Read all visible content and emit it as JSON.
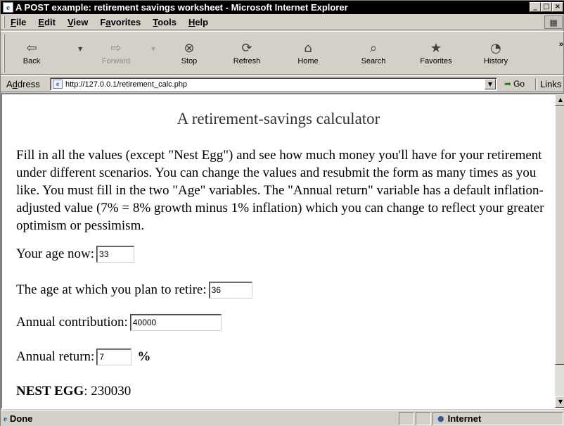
{
  "window": {
    "title": "A POST example: retirement savings worksheet - Microsoft Internet Explorer",
    "controls": {
      "minimize": "_",
      "maximize": "□",
      "close": "×"
    }
  },
  "menu": {
    "items": [
      {
        "hot": "F",
        "rest": "ile"
      },
      {
        "hot": "E",
        "rest": "dit"
      },
      {
        "hot": "V",
        "rest": "iew"
      },
      {
        "pre": "F",
        "hot": "a",
        "rest": "vorites"
      },
      {
        "hot": "T",
        "rest": "ools"
      },
      {
        "hot": "H",
        "rest": "elp"
      }
    ]
  },
  "toolbar": {
    "back": {
      "label": "Back",
      "icon": "back-arrow-icon",
      "glyph": "⇦"
    },
    "forward": {
      "label": "Forward",
      "icon": "forward-arrow-icon",
      "glyph": "⇨"
    },
    "stop": {
      "label": "Stop",
      "icon": "stop-icon",
      "glyph": "⊗"
    },
    "refresh": {
      "label": "Refresh",
      "icon": "refresh-icon",
      "glyph": "⟳"
    },
    "home": {
      "label": "Home",
      "icon": "home-icon",
      "glyph": "⌂"
    },
    "search": {
      "label": "Search",
      "icon": "search-icon",
      "glyph": "⌕"
    },
    "favorites": {
      "label": "Favorites",
      "icon": "favorites-icon",
      "glyph": "★"
    },
    "history": {
      "label": "History",
      "icon": "history-icon",
      "glyph": "◔"
    },
    "dropdown_glyph": "▼",
    "more_glyph": "»"
  },
  "address": {
    "label_pre": "A",
    "label_hot": "d",
    "label_rest": "dress",
    "url": "http://127.0.0.1/retirement_calc.php",
    "go_label": "Go",
    "links_label": "Links"
  },
  "page": {
    "title": "A retirement-savings calculator",
    "intro": "Fill in all the values (except \"Nest Egg\") and see how much money you'll have for your retirement under different scenarios. You can change the values and resubmit the form as many times as you like. You must fill in the two \"Age\" variables. The \"Annual return\" variable has a default inflation-adjusted value (7% = 8% growth minus 1% inflation) which you can change to reflect your greater optimism or pessimism.",
    "fields": {
      "age_now": {
        "label": "Your age now:",
        "value": "33"
      },
      "retire_age": {
        "label": "The age at which you plan to retire:",
        "value": "36"
      },
      "contribution": {
        "label": "Annual contribution:",
        "value": "40000"
      },
      "annual_return": {
        "label": "Annual return:",
        "value": "7",
        "suffix": "%"
      }
    },
    "nest_egg": {
      "label": "NEST EGG",
      "value": ": 230030"
    }
  },
  "status": {
    "text": "Done",
    "zone": "Internet"
  }
}
